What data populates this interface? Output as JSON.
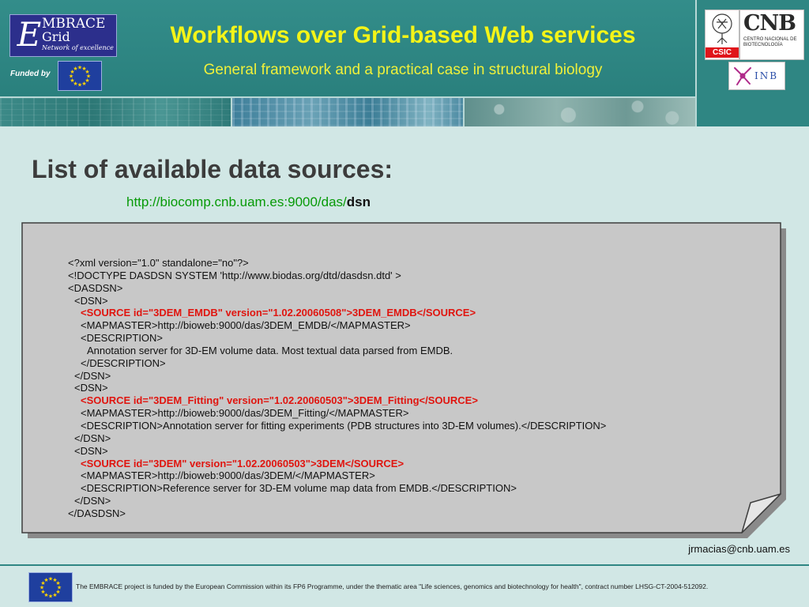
{
  "header": {
    "title": "Workflows over Grid-based Web services",
    "subtitle": "General framework and a practical case in structural biology",
    "embrace_logo": {
      "letter": "E",
      "name": "MBRACE",
      "sub": "Grid",
      "tagline": "Network of excellence"
    },
    "funded_label": "Funded by",
    "partner_logos": {
      "csic": "CSIC",
      "cnb_big": "CNB",
      "cnb_small": "Centro Nacional de Biotecnología",
      "inb": "INB"
    }
  },
  "main": {
    "heading": "List of available data sources:",
    "url_base": "http://biocomp.cnb.uam.es:9000/das/",
    "url_suffix": "dsn",
    "xml_lines": [
      {
        "text": "<?xml version=\"1.0\" standalone=\"no\"?>",
        "indent": 0,
        "highlight": false
      },
      {
        "text": "<!DOCTYPE DASDSN SYSTEM 'http://www.biodas.org/dtd/dasdsn.dtd' >",
        "indent": 0,
        "highlight": false
      },
      {
        "text": "<DASDSN>",
        "indent": 0,
        "highlight": false
      },
      {
        "text": "<DSN>",
        "indent": 1,
        "highlight": false
      },
      {
        "text": "<SOURCE id=\"3DEM_EMDB\" version=\"1.02.20060508\">3DEM_EMDB</SOURCE>",
        "indent": 2,
        "highlight": true
      },
      {
        "text": "<MAPMASTER>http://bioweb:9000/das/3DEM_EMDB/</MAPMASTER>",
        "indent": 2,
        "highlight": false
      },
      {
        "text": "<DESCRIPTION>",
        "indent": 2,
        "highlight": false
      },
      {
        "text": "Annotation server for 3D-EM volume data. Most textual data parsed from EMDB.",
        "indent": 3,
        "highlight": false
      },
      {
        "text": "</DESCRIPTION>",
        "indent": 2,
        "highlight": false
      },
      {
        "text": "</DSN>",
        "indent": 1,
        "highlight": false
      },
      {
        "text": "<DSN>",
        "indent": 1,
        "highlight": false
      },
      {
        "text": "<SOURCE id=\"3DEM_Fitting\" version=\"1.02.20060503\">3DEM_Fitting</SOURCE>",
        "indent": 2,
        "highlight": true
      },
      {
        "text": "<MAPMASTER>http://bioweb:9000/das/3DEM_Fitting/</MAPMASTER>",
        "indent": 2,
        "highlight": false
      },
      {
        "text": "<DESCRIPTION>Annotation server for fitting experiments (PDB structures into 3D-EM volumes).</DESCRIPTION>",
        "indent": 2,
        "highlight": false
      },
      {
        "text": "</DSN>",
        "indent": 1,
        "highlight": false
      },
      {
        "text": "<DSN>",
        "indent": 1,
        "highlight": false
      },
      {
        "text": "<SOURCE id=\"3DEM\" version=\"1.02.20060503\">3DEM</SOURCE>",
        "indent": 2,
        "highlight": true
      },
      {
        "text": "<MAPMASTER>http://bioweb:9000/das/3DEM/</MAPMASTER>",
        "indent": 2,
        "highlight": false
      },
      {
        "text": "<DESCRIPTION>Reference server for 3D-EM volume map data from EMDB.</DESCRIPTION>",
        "indent": 2,
        "highlight": false
      },
      {
        "text": "</DSN>",
        "indent": 1,
        "highlight": false
      },
      {
        "text": "</DASDSN>",
        "indent": 0,
        "highlight": false
      }
    ],
    "contact_email": "jrmacias@cnb.uam.es"
  },
  "footer": {
    "funding_note": "The EMBRACE project is funded by the European Commission within its FP6 Programme, under the thematic area \"Life sciences, genomics and biotechnology for health\", contract number LHSG-CT-2004-512092."
  },
  "colors": {
    "header_teal": "#2f8683",
    "title_yellow": "#f4f418",
    "page_background": "#d1e7e5",
    "note_gray": "#c8c8c8",
    "url_green": "#079a07",
    "highlight_red": "#e0150f"
  },
  "icons": {
    "eu_flag": "eu-flag-icon",
    "ribbon": "inb-ribbon-icon",
    "tree": "csic-tree-icon"
  }
}
